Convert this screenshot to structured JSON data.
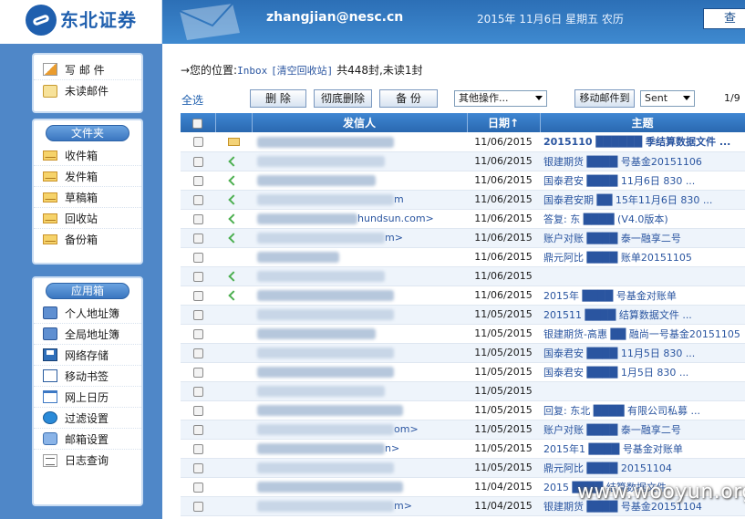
{
  "brand": {
    "logo_text": "东北证券"
  },
  "header": {
    "email": "zhangjian@nesc.cn",
    "date": "2015年 11月6日 星期五 农历",
    "right_button": "查"
  },
  "sidebar": {
    "top_items": [
      {
        "label": "写 邮 件",
        "icon": "compose-icon"
      },
      {
        "label": "未读邮件",
        "icon": "unread-icon"
      }
    ],
    "folders_title": "文件夹",
    "folders": [
      {
        "label": "收件箱",
        "icon": "envelope-icon"
      },
      {
        "label": "发件箱",
        "icon": "envelope-icon"
      },
      {
        "label": "草稿箱",
        "icon": "envelope-icon"
      },
      {
        "label": "回收站",
        "icon": "envelope-icon"
      },
      {
        "label": "备份箱",
        "icon": "envelope-icon"
      }
    ],
    "apps_title": "应用箱",
    "apps": [
      {
        "label": "个人地址簿",
        "icon": "address-book-icon"
      },
      {
        "label": "全局地址簿",
        "icon": "global-address-book-icon"
      },
      {
        "label": "网络存储",
        "icon": "disk-icon"
      },
      {
        "label": "移动书签",
        "icon": "bookmark-icon"
      },
      {
        "label": "网上日历",
        "icon": "calendar-icon"
      },
      {
        "label": "过滤设置",
        "icon": "filter-icon"
      },
      {
        "label": "邮箱设置",
        "icon": "mailbox-settings-icon"
      },
      {
        "label": "日志查询",
        "icon": "log-icon"
      }
    ]
  },
  "location": {
    "prefix": "→您的位置:",
    "folder": "Inbox",
    "clear_link": "[清空回收站]",
    "count": "共448封,未读1封"
  },
  "toolbar": {
    "select_all": "全选",
    "delete_btn": "删 除",
    "hard_delete_btn": "彻底删除",
    "backup_btn": "备 份",
    "other_ops": "其他操作...",
    "move_btn": "移动邮件到",
    "move_target": "Sent",
    "pager": "1/9"
  },
  "table": {
    "columns": {
      "from": "发信人",
      "date": "日期↑",
      "subject": "主题"
    },
    "rows": [
      {
        "icon": "envelope",
        "from": "",
        "date": "11/06/2015",
        "subject": "2015110 ██████ 季结算数据文件 ...",
        "bold": true
      },
      {
        "icon": "reply",
        "from": "",
        "date": "11/06/2015",
        "subject": "银建期货 ████ 号基金20151106",
        "bold": false
      },
      {
        "icon": "reply",
        "from": "",
        "date": "11/06/2015",
        "subject": "国泰君安 ████ 11月6日 830 ...",
        "bold": false
      },
      {
        "icon": "reply",
        "from": "m",
        "date": "11/06/2015",
        "subject": "国泰君安期 ██ 15年11月6日 830 ...",
        "bold": false
      },
      {
        "icon": "reply",
        "from": "hundsun.com>",
        "date": "11/06/2015",
        "subject": "答复: 东 ████ (V4.0版本)",
        "bold": false
      },
      {
        "icon": "reply",
        "from": "m>",
        "date": "11/06/2015",
        "subject": "账户对账 ████ 泰一融享二号",
        "bold": false
      },
      {
        "icon": "",
        "from": "",
        "date": "11/06/2015",
        "subject": "鼎元阿比 ████ 账单20151105",
        "bold": false
      },
      {
        "icon": "reply",
        "from": "",
        "date": "11/06/2015",
        "subject": "",
        "bold": false
      },
      {
        "icon": "reply",
        "from": "",
        "date": "11/06/2015",
        "subject": "2015年 ████ 号基金对账单",
        "bold": false
      },
      {
        "icon": "",
        "from": "",
        "date": "11/05/2015",
        "subject": "201511 ████ 结算数据文件 ...",
        "bold": false
      },
      {
        "icon": "",
        "from": "",
        "date": "11/05/2015",
        "subject": "银建期货-高惠 ██ 融尚一号基金20151105",
        "bold": false
      },
      {
        "icon": "",
        "from": "",
        "date": "11/05/2015",
        "subject": "国泰君安 ████ 11月5日 830 ...",
        "bold": false
      },
      {
        "icon": "",
        "from": "",
        "date": "11/05/2015",
        "subject": "国泰君安 ████ 1月5日 830 ...",
        "bold": false
      },
      {
        "icon": "",
        "from": "",
        "date": "11/05/2015",
        "subject": "",
        "bold": false
      },
      {
        "icon": "",
        "from": "",
        "date": "11/05/2015",
        "subject": "回复: 东北 ████ 有限公司私募 ...",
        "bold": false
      },
      {
        "icon": "",
        "from": "om>",
        "date": "11/05/2015",
        "subject": "账户对账 ████ 泰一融享二号",
        "bold": false
      },
      {
        "icon": "",
        "from": "n>",
        "date": "11/05/2015",
        "subject": "2015年1 ████ 号基金对账单",
        "bold": false
      },
      {
        "icon": "",
        "from": "",
        "date": "11/05/2015",
        "subject": "鼎元阿比 ████ 20151104",
        "bold": false
      },
      {
        "icon": "",
        "from": "",
        "date": "11/04/2015",
        "subject": "2015 ████ 结算数据文件",
        "bold": false
      },
      {
        "icon": "",
        "from": "m>",
        "date": "11/04/2015",
        "subject": "银建期货 ████ 号基金20151104",
        "bold": false
      }
    ]
  },
  "watermark": "www.wooyun.org",
  "colors": {
    "header": "#2c6fb6",
    "sidebar": "#4f87c8",
    "link": "#2a55a0",
    "table_head": "#2a68b0"
  }
}
